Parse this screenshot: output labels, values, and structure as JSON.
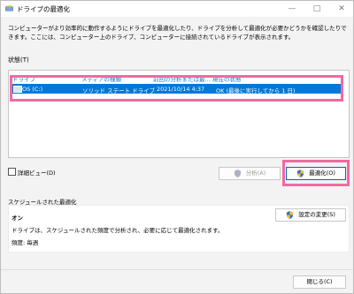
{
  "title": "ドライブの最適化",
  "window_controls": {
    "minimize": "—",
    "maximize": "□",
    "close": "✕"
  },
  "description": "コンピューターがより効率的に動作するようにドライブを最適化したり、ドライブを分析して最適化が必要かどうかを確認したりできます。ここには、コンピューター上のドライブ、コンピューターに接続されているドライブが表示されます。",
  "status_label": "状態(T)",
  "table": {
    "headers": [
      "ドライブ",
      "メディアの種類",
      "前回の分析または最…",
      "現在の状態"
    ],
    "rows": [
      {
        "drive": "OS (C:)",
        "media": "ソリッド ステート ドライブ",
        "last": "2021/10/14 4:37",
        "status": "OK (最後に実行してから 1 日)"
      }
    ]
  },
  "detail_view": "詳細ビュー(D)",
  "buttons": {
    "analyze": "分析(A)",
    "optimize": "最適化(O)",
    "change_settings": "設定の変更(S)",
    "close": "閉じる(C)"
  },
  "schedule": {
    "title": "スケジュールされた最適化",
    "state": "オン",
    "description": "ドライブは、スケジュールされた頻度で分析され、必要に応じて最適化されます。",
    "frequency": "頻度: 毎週"
  },
  "colors": {
    "accent": "#0078d7",
    "highlight": "#f06aa2"
  }
}
